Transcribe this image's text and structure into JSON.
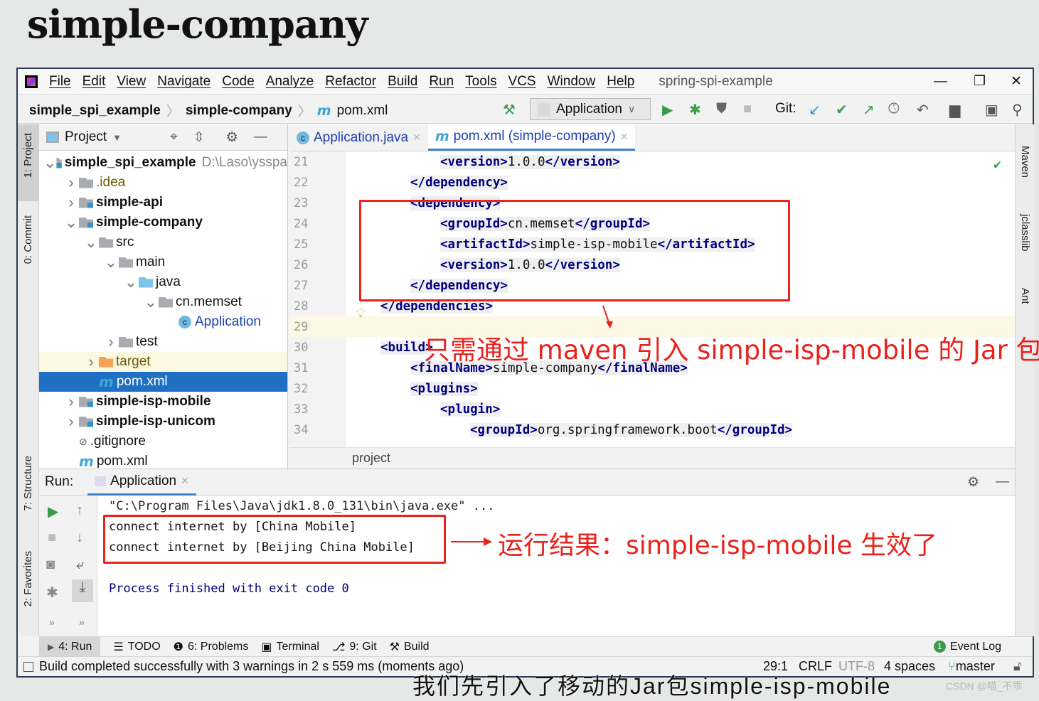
{
  "slide_title": "simple-company",
  "menu": [
    "File",
    "Edit",
    "View",
    "Navigate",
    "Code",
    "Analyze",
    "Refactor",
    "Build",
    "Run",
    "Tools",
    "VCS",
    "Window",
    "Help"
  ],
  "window_title": "spring-spi-example",
  "breadcrumb": {
    "root": "simple_spi_example",
    "module": "simple-company",
    "file": "pom.xml"
  },
  "run_config": "Application",
  "git_label": "Git:",
  "project_panel": {
    "title": "Project",
    "tree": [
      {
        "label": "simple_spi_example",
        "hint": "D:\\Laso\\ysspa",
        "depth": 0,
        "chev": "v",
        "icon": "module",
        "bold": true
      },
      {
        "label": ".idea",
        "depth": 1,
        "chev": ">",
        "icon": "folder",
        "color": "#6b5b00"
      },
      {
        "label": "simple-api",
        "depth": 1,
        "chev": ">",
        "icon": "module",
        "bold": true
      },
      {
        "label": "simple-company",
        "depth": 1,
        "chev": "v",
        "icon": "module",
        "bold": true
      },
      {
        "label": "src",
        "depth": 2,
        "chev": "v",
        "icon": "folder"
      },
      {
        "label": "main",
        "depth": 3,
        "chev": "v",
        "icon": "folder"
      },
      {
        "label": "java",
        "depth": 4,
        "chev": "v",
        "icon": "source-folder"
      },
      {
        "label": "cn.memset",
        "depth": 5,
        "chev": "v",
        "icon": "package"
      },
      {
        "label": "Application",
        "depth": 6,
        "chev": "",
        "icon": "class",
        "color": "#1a3fb0"
      },
      {
        "label": "test",
        "depth": 3,
        "chev": ">",
        "icon": "folder"
      },
      {
        "label": "target",
        "depth": 2,
        "chev": ">",
        "icon": "excluded-folder",
        "color": "#6b5b00",
        "highlight": "#fbf8e2"
      },
      {
        "label": "pom.xml",
        "depth": 2,
        "chev": "",
        "icon": "maven",
        "selected": true
      },
      {
        "label": "simple-isp-mobile",
        "depth": 1,
        "chev": ">",
        "icon": "module",
        "bold": true
      },
      {
        "label": "simple-isp-unicom",
        "depth": 1,
        "chev": ">",
        "icon": "module",
        "bold": true
      },
      {
        "label": ".gitignore",
        "depth": 1,
        "chev": "",
        "icon": "ignore-file"
      },
      {
        "label": "pom.xml",
        "depth": 1,
        "chev": "",
        "icon": "maven"
      }
    ]
  },
  "editor": {
    "tabs": [
      {
        "label": "Application.java",
        "active": false
      },
      {
        "label": "pom.xml (simple-company)",
        "active": true
      }
    ],
    "lines": [
      {
        "n": "21",
        "indent": 2,
        "parts": [
          [
            "tag",
            "<version>"
          ],
          [
            "txt",
            "1.0.0"
          ],
          [
            "tag",
            "</version>"
          ]
        ]
      },
      {
        "n": "22",
        "indent": 1,
        "parts": [
          [
            "tag",
            "</dependency>"
          ]
        ]
      },
      {
        "n": "23",
        "indent": 1,
        "parts": [
          [
            "tag",
            "<dependency>"
          ]
        ]
      },
      {
        "n": "24",
        "indent": 2,
        "parts": [
          [
            "tag",
            "<groupId>"
          ],
          [
            "txt",
            "cn.memset"
          ],
          [
            "tag",
            "</groupId>"
          ]
        ]
      },
      {
        "n": "25",
        "indent": 2,
        "parts": [
          [
            "tag",
            "<artifactId>"
          ],
          [
            "txt",
            "simple-isp-mobile"
          ],
          [
            "tag",
            "</artifactId>"
          ]
        ]
      },
      {
        "n": "26",
        "indent": 2,
        "parts": [
          [
            "tag",
            "<version>"
          ],
          [
            "txt",
            "1.0.0"
          ],
          [
            "tag",
            "</version>"
          ]
        ]
      },
      {
        "n": "27",
        "indent": 1,
        "parts": [
          [
            "tag",
            "</dependency>"
          ]
        ]
      },
      {
        "n": "28",
        "indent": 0,
        "parts": [
          [
            "tag",
            "</dependencies>"
          ]
        ]
      },
      {
        "n": "29",
        "indent": 0,
        "parts": []
      },
      {
        "n": "30",
        "indent": 0,
        "parts": [
          [
            "tag",
            "<build>"
          ]
        ]
      },
      {
        "n": "31",
        "indent": 1,
        "parts": [
          [
            "tag",
            "<finalName>"
          ],
          [
            "txt",
            "simple-company"
          ],
          [
            "tag",
            "</finalName>"
          ]
        ]
      },
      {
        "n": "32",
        "indent": 1,
        "parts": [
          [
            "tag",
            "<plugins>"
          ]
        ]
      },
      {
        "n": "33",
        "indent": 2,
        "parts": [
          [
            "tag",
            "<plugin>"
          ]
        ]
      },
      {
        "n": "34",
        "indent": 3,
        "parts": [
          [
            "tag",
            "<groupId>"
          ],
          [
            "txt",
            "org.springframework.boot"
          ],
          [
            "tag",
            "</groupId>"
          ]
        ]
      }
    ],
    "breadcrumb": "project"
  },
  "right_strip": [
    "Maven",
    "jclasslib",
    "Ant"
  ],
  "left_strip": [
    "1: Project",
    "0: Commit",
    "7: Structure",
    "2: Favorites"
  ],
  "run": {
    "label": "Run:",
    "tab": "Application",
    "console": [
      "\"C:\\Program Files\\Java\\jdk1.8.0_131\\bin\\java.exe\" ...",
      "connect internet by [China Mobile]",
      "connect internet by [Beijing China Mobile]",
      "",
      "Process finished with exit code 0"
    ]
  },
  "bottom_tools": [
    "4: Run",
    "TODO",
    "6: Problems",
    "Terminal",
    "9: Git",
    "Build"
  ],
  "event_log": {
    "label": "Event Log",
    "count": "1"
  },
  "status": {
    "message": "Build completed successfully with 3 warnings in 2 s 559 ms (moments ago)",
    "position": "29:1",
    "line_sep": "CRLF",
    "encoding": "UTF-8",
    "indent": "4 spaces",
    "branch": "master"
  },
  "annotations": {
    "editor_note": "只需通过 maven 引入 simple-isp-mobile 的 Jar 包",
    "console_note": "运行结果：simple-isp-mobile 生效了",
    "subtitle": "我们先引入了移动的Jar包simple-isp-mobile",
    "watermark": "CSDN @喵_不乖"
  },
  "colors": {
    "annotation": "#e8231c",
    "selection": "#1f6fc5",
    "tag": "#000080"
  }
}
